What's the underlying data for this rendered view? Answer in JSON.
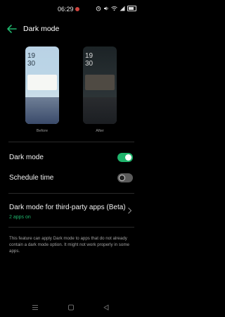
{
  "status": {
    "time": "06:29"
  },
  "header": {
    "title": "Dark mode"
  },
  "preview": {
    "before": {
      "clock_hour": "19",
      "clock_minute": "30",
      "label": "Before"
    },
    "after": {
      "clock_hour": "19",
      "clock_minute": "30",
      "label": "After"
    }
  },
  "settings": {
    "dark_mode": {
      "label": "Dark mode",
      "enabled": true
    },
    "schedule_time": {
      "label": "Schedule time",
      "enabled": false
    }
  },
  "third_party": {
    "title": "Dark mode for third-party apps (Beta)",
    "subtitle": "2 apps on"
  },
  "note": "This feature can apply Dark mode to apps that do not already contain a dark mode option. It might not work properly in some apps.",
  "colors": {
    "accent": "#1fb36b",
    "background": "#000000"
  },
  "icons": {
    "back": "back-arrow-icon",
    "chevron": "chevron-right-icon",
    "nav": [
      "menu-icon",
      "home-icon",
      "back-icon"
    ]
  }
}
